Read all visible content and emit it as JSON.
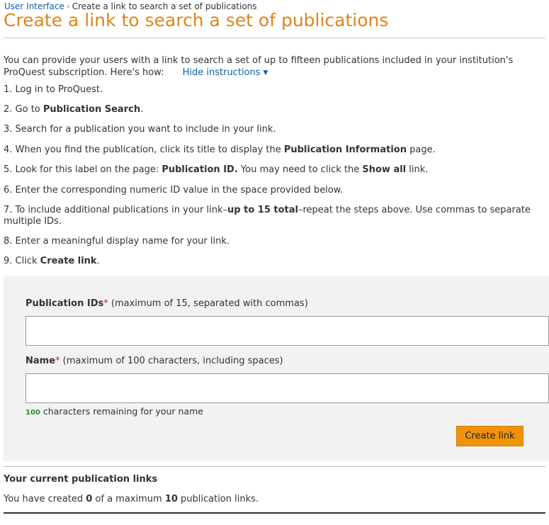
{
  "breadcrumb": {
    "parent": "User Interface",
    "separator": "›",
    "current": "Create a link to search a set of publications"
  },
  "page_title": "Create a link to search a set of publications",
  "intro": {
    "text": "You can provide your users with a link to search a set of up to fifteen publications included in your institution's ProQuest subscription. Here's how:",
    "hide_instructions_label": "Hide instructions",
    "hide_instructions_icon": "triangle-down-icon"
  },
  "steps": [
    {
      "n": "1.",
      "pre": "Log in to ProQuest.",
      "b1": "",
      "mid": "",
      "b2": "",
      "post": ""
    },
    {
      "n": "2.",
      "pre": "Go to ",
      "b1": "Publication Search",
      "mid": ".",
      "b2": "",
      "post": ""
    },
    {
      "n": "3.",
      "pre": "Search for a publication you want to include in your link.",
      "b1": "",
      "mid": "",
      "b2": "",
      "post": ""
    },
    {
      "n": "4.",
      "pre": "When you find the publication, click its title to display the ",
      "b1": "Publication Information",
      "mid": " page.",
      "b2": "",
      "post": ""
    },
    {
      "n": "5.",
      "pre": "Look for this label on the page: ",
      "b1": "Publication ID.",
      "mid": " You may need to click the ",
      "b2": "Show all",
      "post": " link."
    },
    {
      "n": "6.",
      "pre": "Enter the corresponding numeric ID value in the space provided below.",
      "b1": "",
      "mid": "",
      "b2": "",
      "post": ""
    },
    {
      "n": "7.",
      "pre": "To include additional publications in your link–",
      "b1": "up to 15 total",
      "mid": "–repeat the steps above. Use commas to separate multiple IDs.",
      "b2": "",
      "post": ""
    },
    {
      "n": "8.",
      "pre": "Enter a meaningful display name for your link.",
      "b1": "",
      "mid": "",
      "b2": "",
      "post": ""
    },
    {
      "n": "9.",
      "pre": "Click ",
      "b1": "Create link",
      "mid": ".",
      "b2": "",
      "post": ""
    }
  ],
  "form": {
    "publication_ids_label": "Publication IDs",
    "publication_ids_required": "*",
    "publication_ids_hint": " (maximum of 15, separated with commas)",
    "publication_ids_value": "",
    "name_label": "Name",
    "name_required": "*",
    "name_hint": " (maximum of 100 characters, including spaces)",
    "name_value": "",
    "remaining_count": "100",
    "remaining_text": " characters remaining for your name",
    "create_button_label": "Create link"
  },
  "current_links": {
    "heading": "Your current publication links",
    "pre": "You have created ",
    "created_count": "0",
    "mid": " of a maximum ",
    "max_count": "10",
    "post": " publication links."
  },
  "colors": {
    "title": "#e0841a",
    "link": "#0d5fa6",
    "button": "#f0930a",
    "required": "#cc2222",
    "remaining_count": "#2a8a2a",
    "panel_bg": "#f2f2f2"
  }
}
